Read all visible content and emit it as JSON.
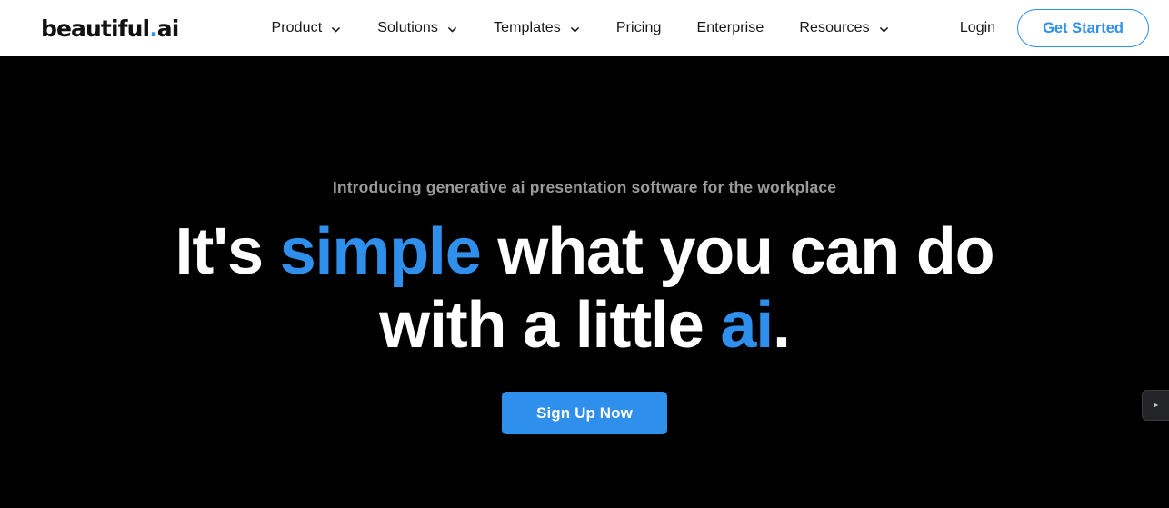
{
  "header": {
    "logo": {
      "name_main": "beautiful",
      "dot": ".",
      "name_suffix": "ai"
    },
    "nav_items": [
      {
        "label": "Product",
        "has_dropdown": true
      },
      {
        "label": "Solutions",
        "has_dropdown": true
      },
      {
        "label": "Templates",
        "has_dropdown": true
      },
      {
        "label": "Pricing",
        "has_dropdown": false
      },
      {
        "label": "Enterprise",
        "has_dropdown": false
      },
      {
        "label": "Resources",
        "has_dropdown": true
      }
    ],
    "login_label": "Login",
    "get_started_label": "Get Started"
  },
  "hero": {
    "eyebrow": "Introducing generative ai presentation software for the workplace",
    "headline_parts": [
      {
        "text": "It's ",
        "accent": false
      },
      {
        "text": "simple",
        "accent": true
      },
      {
        "text": " what you can do with a little ",
        "accent": false
      },
      {
        "text": "ai",
        "accent": true
      },
      {
        "text": ".",
        "accent": false
      }
    ],
    "headline_plain": "It's simple what you can do with a little ai.",
    "cta_label": "Sign Up Now"
  },
  "widgets": {
    "chat_glyph": "➤"
  },
  "colors": {
    "accent_blue": "#2f8fec",
    "hero_background": "#000000",
    "header_background": "#ffffff",
    "eyebrow_gray": "#9a9a9a",
    "nav_text": "#15171a"
  }
}
